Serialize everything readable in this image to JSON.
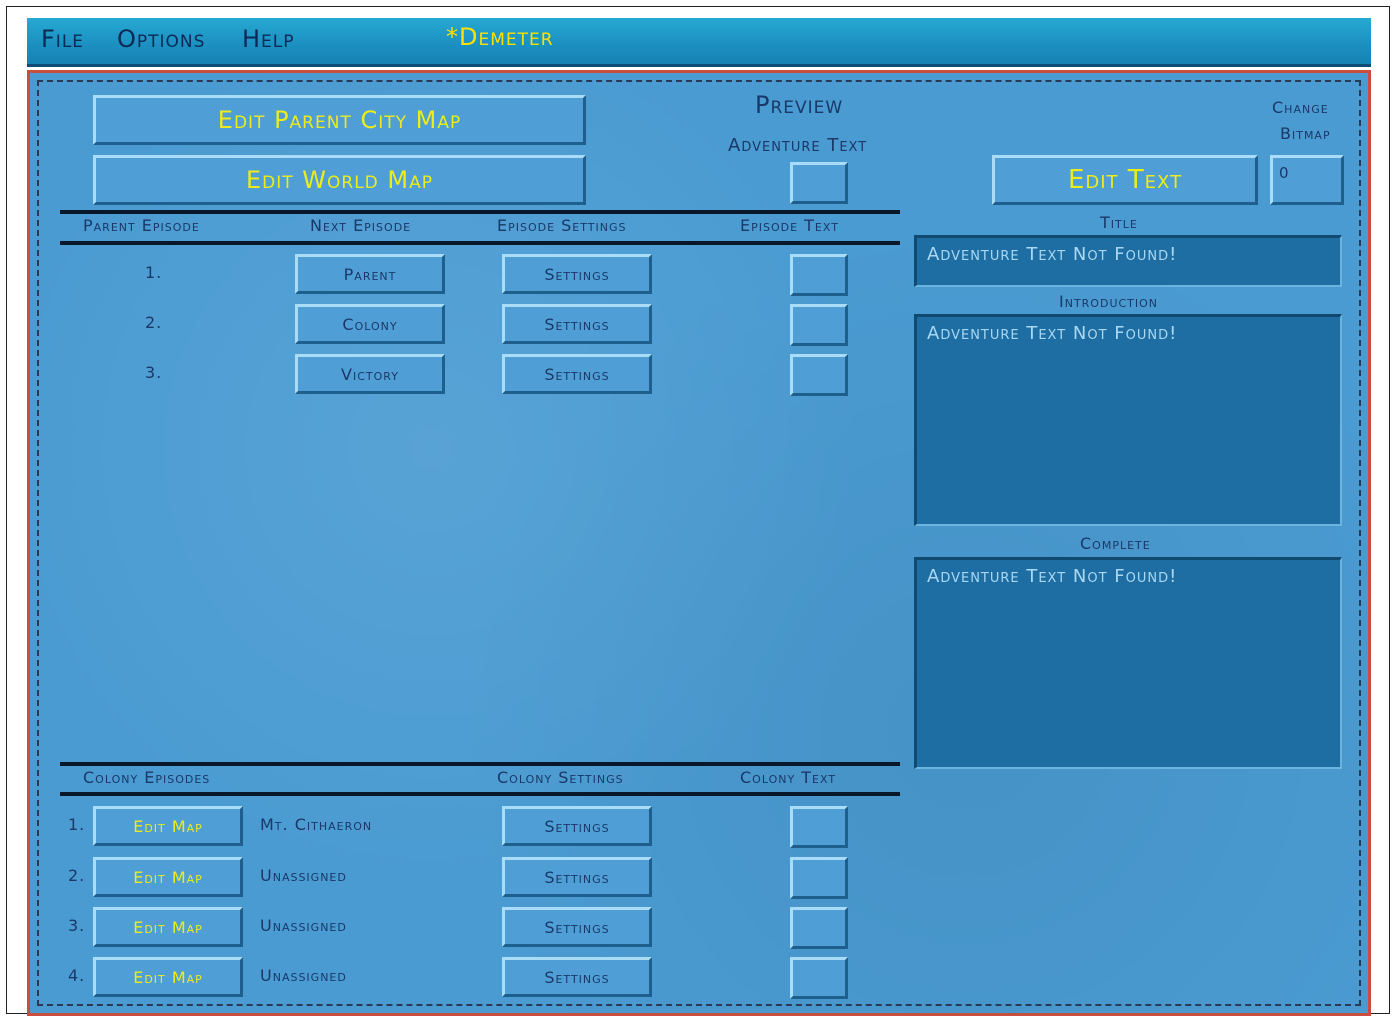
{
  "menu": {
    "file": "File",
    "options": "Options",
    "help": "Help",
    "title": "*Demeter"
  },
  "top": {
    "edit_parent_city_map": "Edit Parent City Map",
    "edit_world_map": "Edit World Map",
    "preview": "Preview",
    "adventure_text": "Adventure Text",
    "change": "Change",
    "bitmap": "Bitmap",
    "edit_text": "Edit Text",
    "bitmap_value": "0"
  },
  "episodes": {
    "headers": {
      "parent": "Parent Episode",
      "next": "Next Episode",
      "settings": "Episode Settings",
      "text": "Episode Text"
    },
    "rows": [
      {
        "num": "1.",
        "next": "Parent",
        "settings": "Settings"
      },
      {
        "num": "2.",
        "next": "Colony",
        "settings": "Settings"
      },
      {
        "num": "3.",
        "next": "Victory",
        "settings": "Settings"
      }
    ]
  },
  "colony": {
    "headers": {
      "episodes": "Colony Episodes",
      "settings": "Colony Settings",
      "text": "Colony Text"
    },
    "rows": [
      {
        "num": "1.",
        "edit": "Edit Map",
        "name": "Mt. Cithaeron",
        "settings": "Settings"
      },
      {
        "num": "2.",
        "edit": "Edit Map",
        "name": "Unassigned",
        "settings": "Settings"
      },
      {
        "num": "3.",
        "edit": "Edit Map",
        "name": "Unassigned",
        "settings": "Settings"
      },
      {
        "num": "4.",
        "edit": "Edit Map",
        "name": "Unassigned",
        "settings": "Settings"
      }
    ]
  },
  "text_panel": {
    "title_label": "Title",
    "title_value": "Adventure Text Not Found!",
    "intro_label": "Introduction",
    "intro_value": "Adventure Text Not Found!",
    "complete_label": "Complete",
    "complete_value": "Adventure Text Not Found!"
  }
}
